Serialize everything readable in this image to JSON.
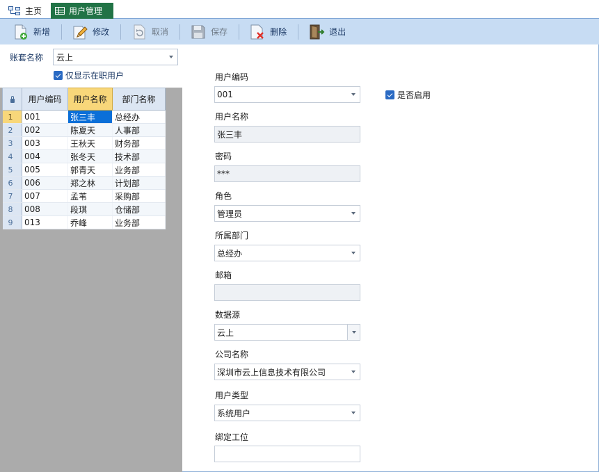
{
  "tabs": [
    {
      "label": "主页"
    },
    {
      "label": "用户管理"
    }
  ],
  "toolbar": {
    "new_label": "新增",
    "edit_label": "修改",
    "cancel_label": "取消",
    "save_label": "保存",
    "delete_label": "删除",
    "exit_label": "退出"
  },
  "filter": {
    "account_label": "账套名称",
    "account_value": "云上",
    "active_only_label": "仅显示在职用户"
  },
  "grid": {
    "columns": [
      "用户编码",
      "用户名称",
      "部门名称"
    ],
    "rows": [
      {
        "num": "1",
        "code": "001",
        "name": "张三丰",
        "dept": "总经办"
      },
      {
        "num": "2",
        "code": "002",
        "name": "陈夏天",
        "dept": "人事部"
      },
      {
        "num": "3",
        "code": "003",
        "name": "王秋天",
        "dept": "财务部"
      },
      {
        "num": "4",
        "code": "004",
        "name": "张冬天",
        "dept": "技术部"
      },
      {
        "num": "5",
        "code": "005",
        "name": "郭青天",
        "dept": "业务部"
      },
      {
        "num": "6",
        "code": "006",
        "name": "郑之林",
        "dept": "计划部"
      },
      {
        "num": "7",
        "code": "007",
        "name": "孟苇",
        "dept": "采购部"
      },
      {
        "num": "8",
        "code": "008",
        "name": "段琪",
        "dept": "仓储部"
      },
      {
        "num": "9",
        "code": "013",
        "name": "乔峰",
        "dept": "业务部"
      }
    ]
  },
  "form": {
    "user_code_label": "用户编码",
    "user_code": "001",
    "enabled_label": "是否启用",
    "user_name_label": "用户名称",
    "user_name": "张三丰",
    "password_label": "密码",
    "password": "***",
    "role_label": "角色",
    "role": "管理员",
    "dept_label": "所属部门",
    "dept": "总经办",
    "email_label": "邮箱",
    "email": "",
    "datasource_label": "数据源",
    "datasource": "云上",
    "company_label": "公司名称",
    "company": "深圳市云上信息技术有限公司",
    "user_type_label": "用户类型",
    "user_type": "系统用户",
    "workstation_label": "绑定工位",
    "workstation": ""
  },
  "colors": {
    "active_tab": "#217346",
    "toolbar_bg": "#c7dcf3",
    "selection": "#0b6fd8",
    "sorted_header": "#f8d77a"
  }
}
